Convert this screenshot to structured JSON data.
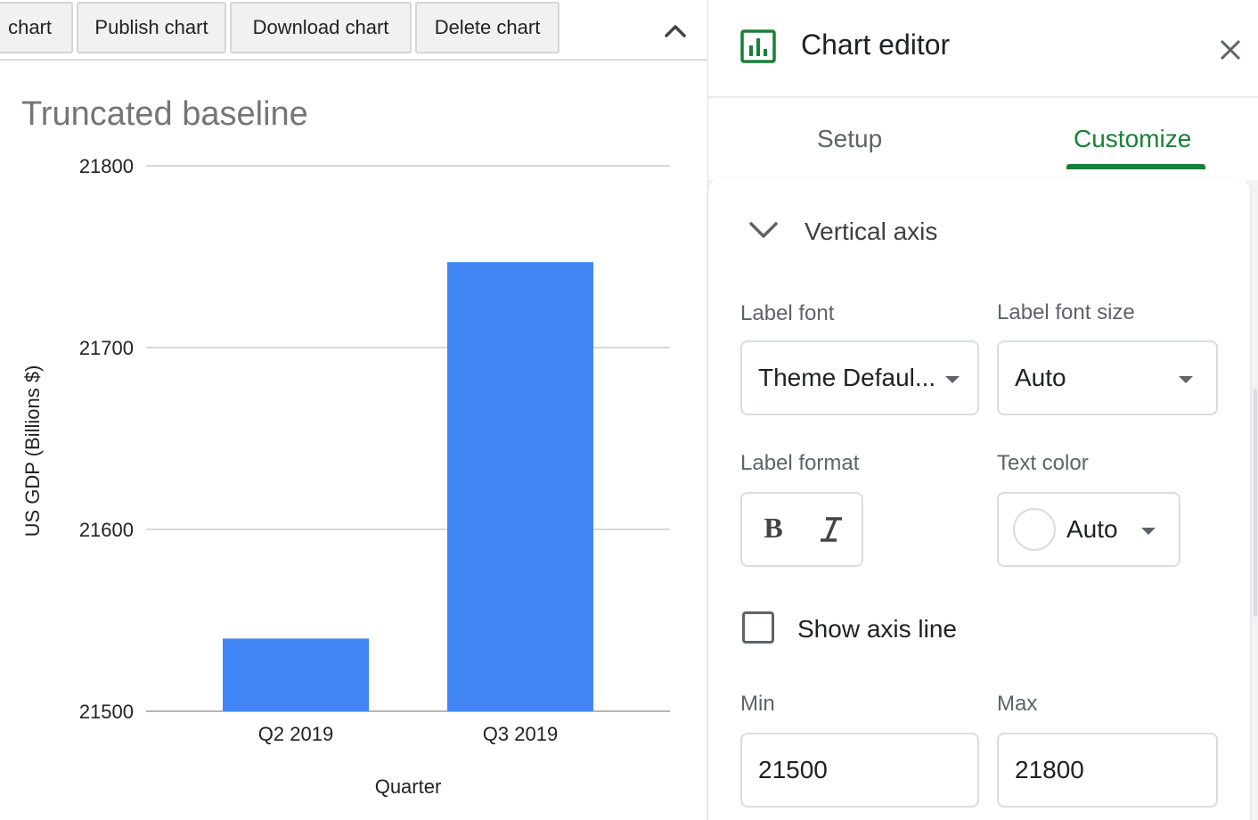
{
  "toolbar": {
    "buttons": [
      "chart",
      "Publish chart",
      "Download chart",
      "Delete chart"
    ],
    "collapse_icon": "chevron-up-icon"
  },
  "chart_data": {
    "type": "bar",
    "title": "Truncated baseline",
    "categories": [
      "Q2 2019",
      "Q3 2019"
    ],
    "values": [
      21540,
      21747
    ],
    "xlabel": "Quarter",
    "ylabel": "US GDP (Billions $)",
    "ylim": [
      21500,
      21800
    ],
    "yticks": [
      21800,
      21700,
      21600,
      21500
    ],
    "grid": true,
    "bar_color": "#4285f4"
  },
  "editor": {
    "title": "Chart editor",
    "icon": "chart-editor-icon",
    "close_icon": "close-icon",
    "tabs": [
      "Setup",
      "Customize"
    ],
    "active_tab": "Customize",
    "accent_color": "#188038",
    "section": {
      "title": "Vertical axis",
      "label_font": {
        "label": "Label font",
        "value": "Theme Defaul..."
      },
      "label_font_size": {
        "label": "Label font size",
        "value": "Auto"
      },
      "label_format": {
        "label": "Label format",
        "bold": "B",
        "italic_icon": "italic-icon"
      },
      "text_color": {
        "label": "Text color",
        "value": "Auto"
      },
      "show_axis_line": {
        "label": "Show axis line",
        "checked": false
      },
      "min": {
        "label": "Min",
        "value": "21500"
      },
      "max": {
        "label": "Max",
        "value": "21800"
      }
    }
  }
}
